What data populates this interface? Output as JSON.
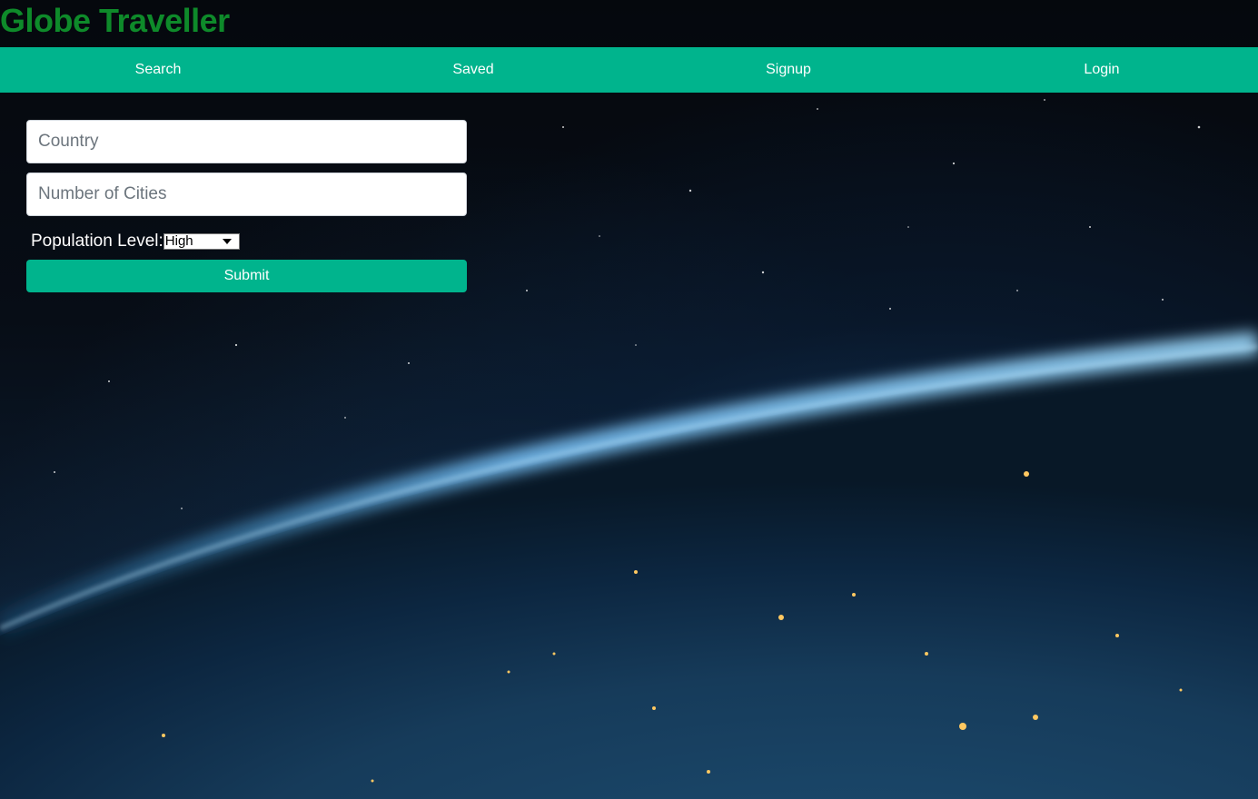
{
  "app": {
    "title": "Globe Traveller",
    "brand_color": "#0e8a2a",
    "accent_color": "#00b48d"
  },
  "nav": {
    "items": [
      {
        "label": "Search"
      },
      {
        "label": "Saved"
      },
      {
        "label": "Signup"
      },
      {
        "label": "Login"
      }
    ]
  },
  "form": {
    "country": {
      "placeholder": "Country",
      "value": ""
    },
    "cities": {
      "placeholder": "Number of Cities",
      "value": ""
    },
    "population": {
      "label": "Population Level:",
      "selected": "High"
    },
    "submit_label": "Submit"
  },
  "background": {
    "image": "earth-from-space-at-night"
  }
}
